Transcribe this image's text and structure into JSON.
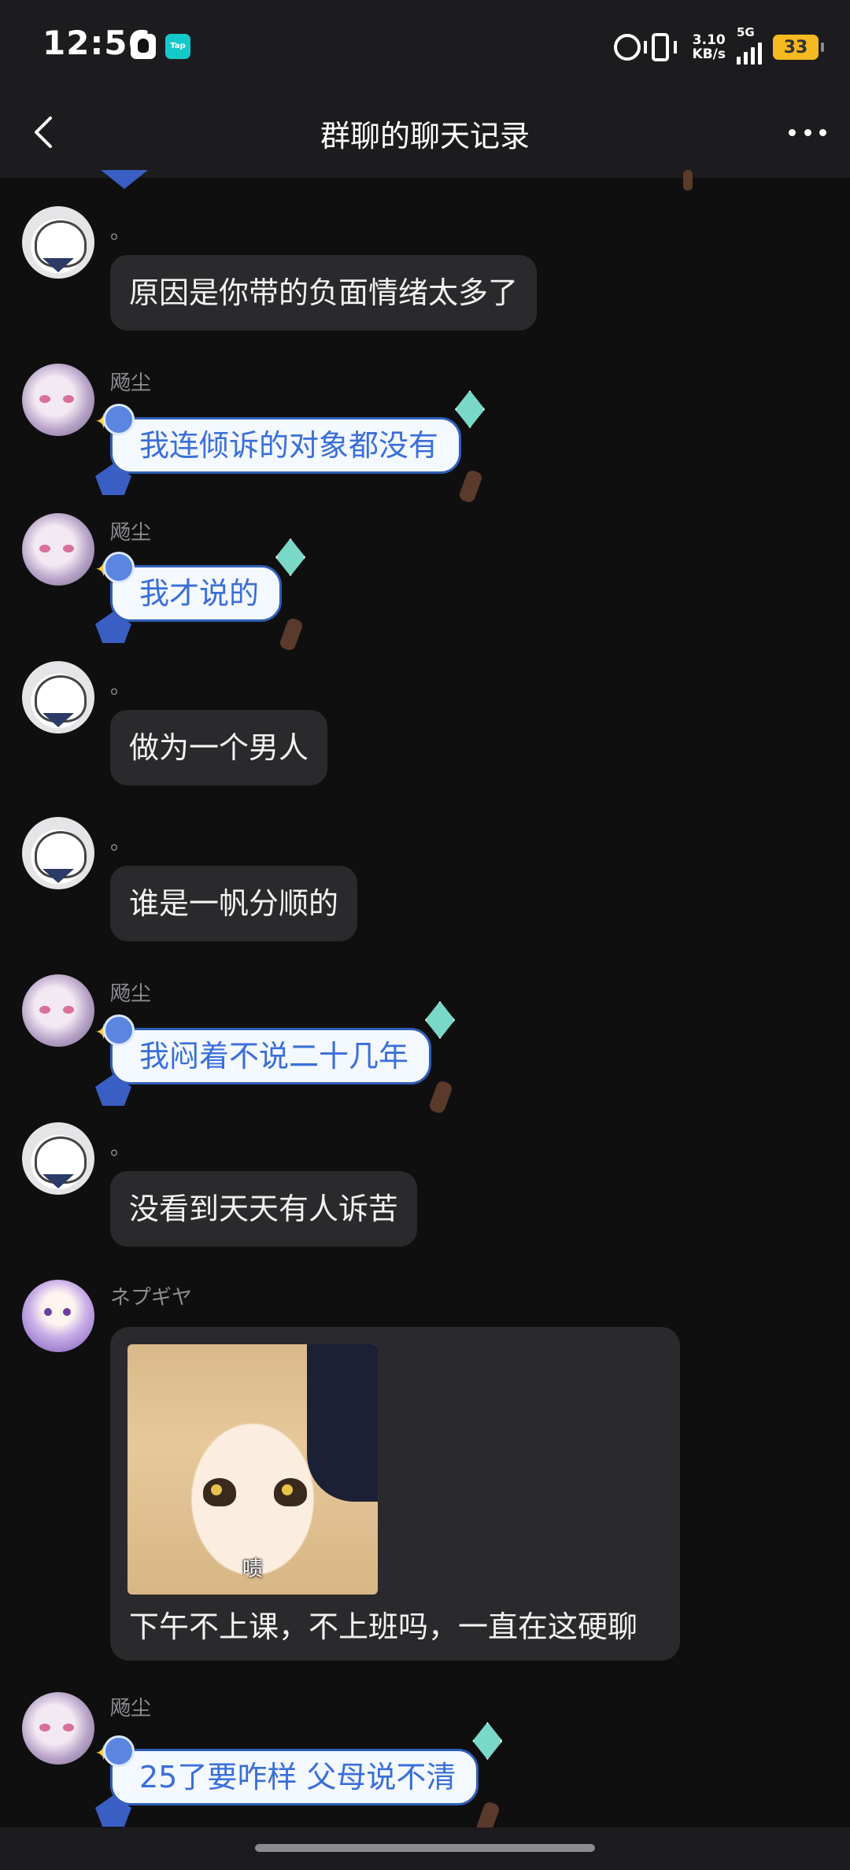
{
  "status_bar": {
    "time": "12:56",
    "app_icon_2_text": "Tap",
    "net_speed_value": "3.10",
    "net_speed_unit": "KB/s",
    "network_type": "5G",
    "battery": "33"
  },
  "header": {
    "title": "群聊的聊天记录"
  },
  "messages": [
    {
      "sender": "。",
      "text": "原因是你带的负面情绪太多了",
      "style": "plain",
      "avatar": "avatar-sketch-girl"
    },
    {
      "sender": "飏尘",
      "text": "我连倾诉的对象都没有",
      "style": "decorated",
      "avatar": "avatar-purple-girl"
    },
    {
      "sender": "飏尘",
      "text": "我才说的",
      "style": "decorated",
      "avatar": "avatar-purple-girl"
    },
    {
      "sender": "。",
      "text": "做为一个男人",
      "style": "plain",
      "avatar": "avatar-sketch-girl"
    },
    {
      "sender": "。",
      "text": "谁是一帆分顺的",
      "style": "plain",
      "avatar": "avatar-sketch-girl"
    },
    {
      "sender": "飏尘",
      "text": "我闷着不说二十几年",
      "style": "decorated",
      "avatar": "avatar-purple-girl"
    },
    {
      "sender": "。",
      "text": "没看到天天有人诉苦",
      "style": "plain",
      "avatar": "avatar-sketch-girl"
    },
    {
      "sender": "ネプギヤ",
      "sticker_caption": "啧",
      "text": "下午不上课，不上班吗，一直在这硬聊",
      "style": "image",
      "avatar": "avatar-violet-girl"
    },
    {
      "sender": "飏尘",
      "text": "25了要咋样  父母说不清",
      "style": "decorated",
      "avatar": "avatar-purple-girl"
    }
  ],
  "colors": {
    "background": "#0f0f10",
    "bar": "#1c1c1e",
    "bubble": "#2a2a2d",
    "decorated_text": "#3a6fd8",
    "battery": "#f5b921"
  }
}
